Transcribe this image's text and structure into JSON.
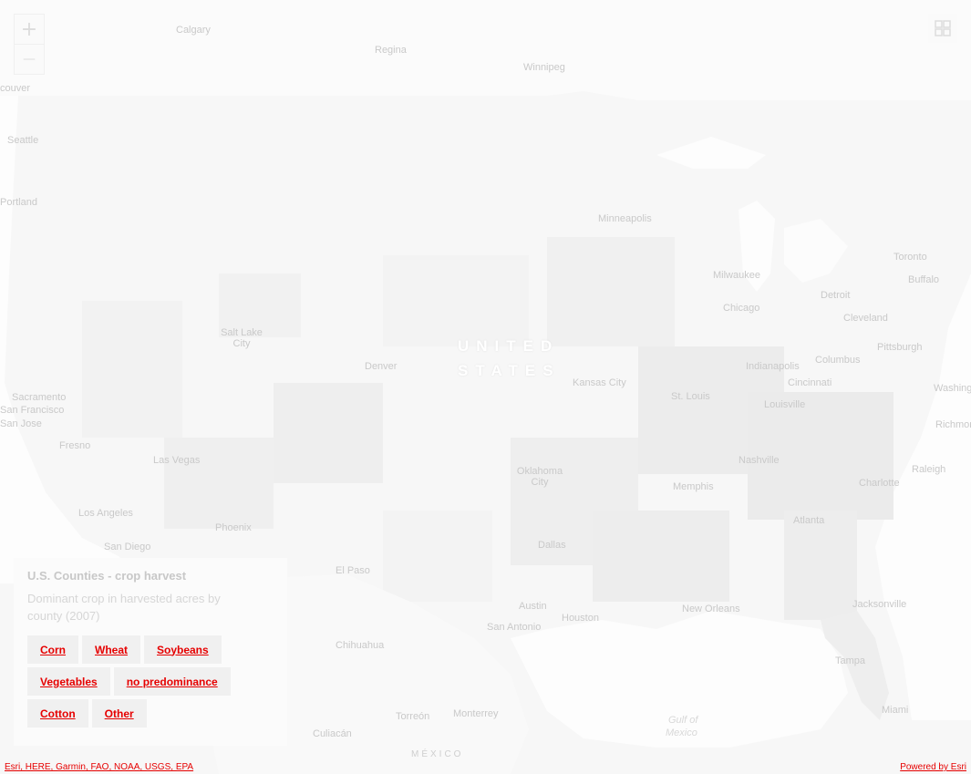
{
  "map": {
    "cities": [
      "Calgary",
      "Regina",
      "Winnipeg",
      "couver",
      "Seattle",
      "Portland",
      "Minneapolis",
      "Milwaukee",
      "Chicago",
      "Detroit",
      "Toronto",
      "Buffalo",
      "Cleveland",
      "Pittsburgh",
      "Columbus",
      "Indianapolis",
      "Cincinnati",
      "Salt Lake City",
      "Denver",
      "Kansas City",
      "St. Louis",
      "Louisville",
      "Sacramento",
      "San Francisco",
      "San Jose",
      "Fresno",
      "Las Vegas",
      "Los Angeles",
      "San Diego",
      "Phoenix",
      "Oklahoma City",
      "Memphis",
      "Nashville",
      "Charlotte",
      "Raleigh",
      "Atlanta",
      "Dallas",
      "El Paso",
      "Austin",
      "Houston",
      "San Antonio",
      "New Orleans",
      "Jacksonville",
      "Tampa",
      "Miami",
      "Washington",
      "Richmond",
      "Chihuahua",
      "Torreón",
      "Monterrey",
      "Culiacán"
    ],
    "country_us": [
      "UNITED",
      "STATES"
    ],
    "country_mx": "MÉXICO",
    "gulf": [
      "Gulf of",
      "Mexico"
    ]
  },
  "controls": {
    "zoom_in": "+",
    "zoom_out": "—",
    "zoom_in_icon": "plus-icon",
    "zoom_out_icon": "minus-icon",
    "basemap_icon": "basemap-gallery-icon"
  },
  "legend": {
    "title": "U.S. Counties - crop harvest",
    "description": "Dominant crop in harvested acres by county (2007)",
    "chips": [
      "Corn",
      "Wheat",
      "Soybeans",
      "Vegetables",
      "no predominance",
      "Cotton",
      "Other"
    ]
  },
  "attribution": {
    "left": "Esri, HERE, Garmin, FAO, NOAA, USGS, EPA",
    "right": "Powered by Esri"
  }
}
